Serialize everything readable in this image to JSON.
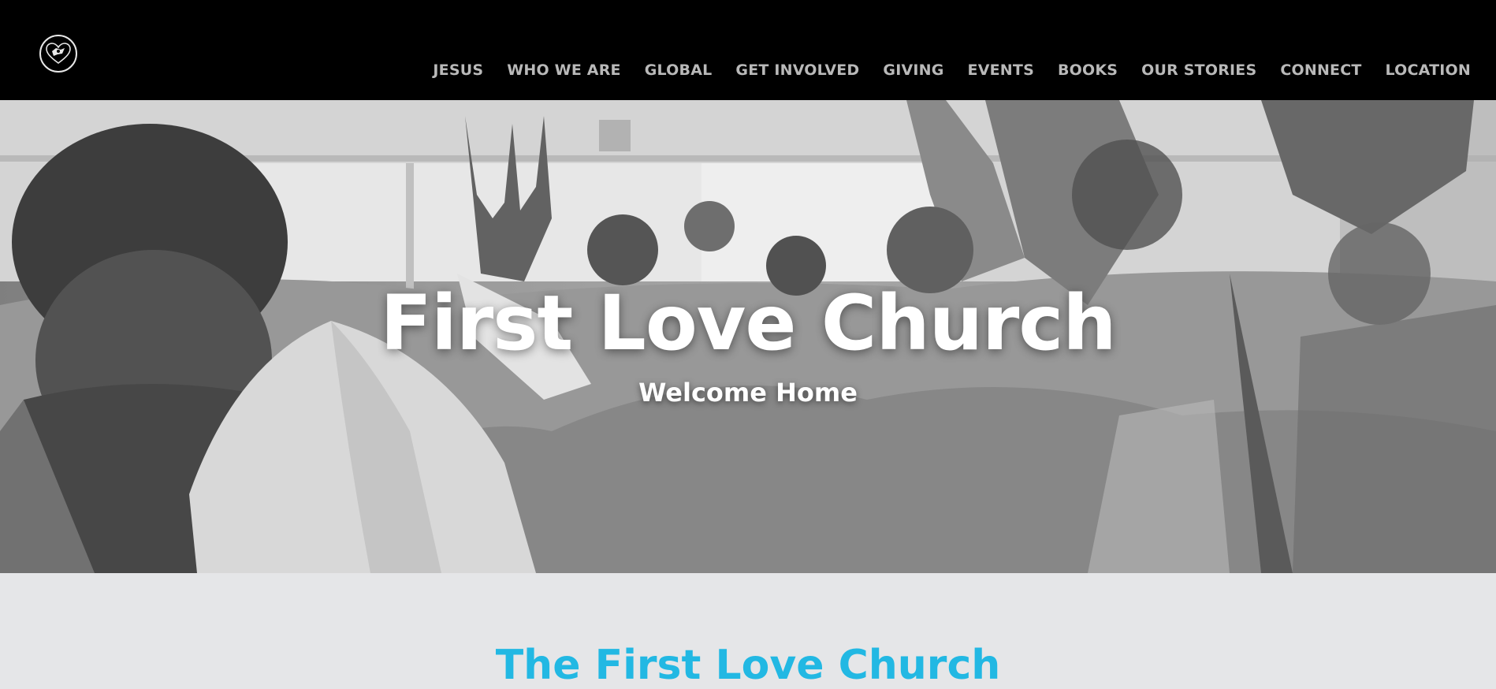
{
  "nav": {
    "items": [
      "JESUS",
      "WHO WE ARE",
      "GLOBAL",
      "GET INVOLVED",
      "GIVING",
      "EVENTS",
      "BOOKS",
      "OUR STORIES",
      "CONNECT",
      "LOCATION"
    ]
  },
  "hero": {
    "title": "First Love Church",
    "subtitle": "Welcome Home"
  },
  "section": {
    "title": "The First Love Church"
  },
  "colors": {
    "header_bg": "#000000",
    "nav_text": "#b9b9b9",
    "accent": "#22b8e3",
    "page_bg": "#e5e6e8"
  },
  "icons": {
    "logo": "church-logo-icon"
  }
}
